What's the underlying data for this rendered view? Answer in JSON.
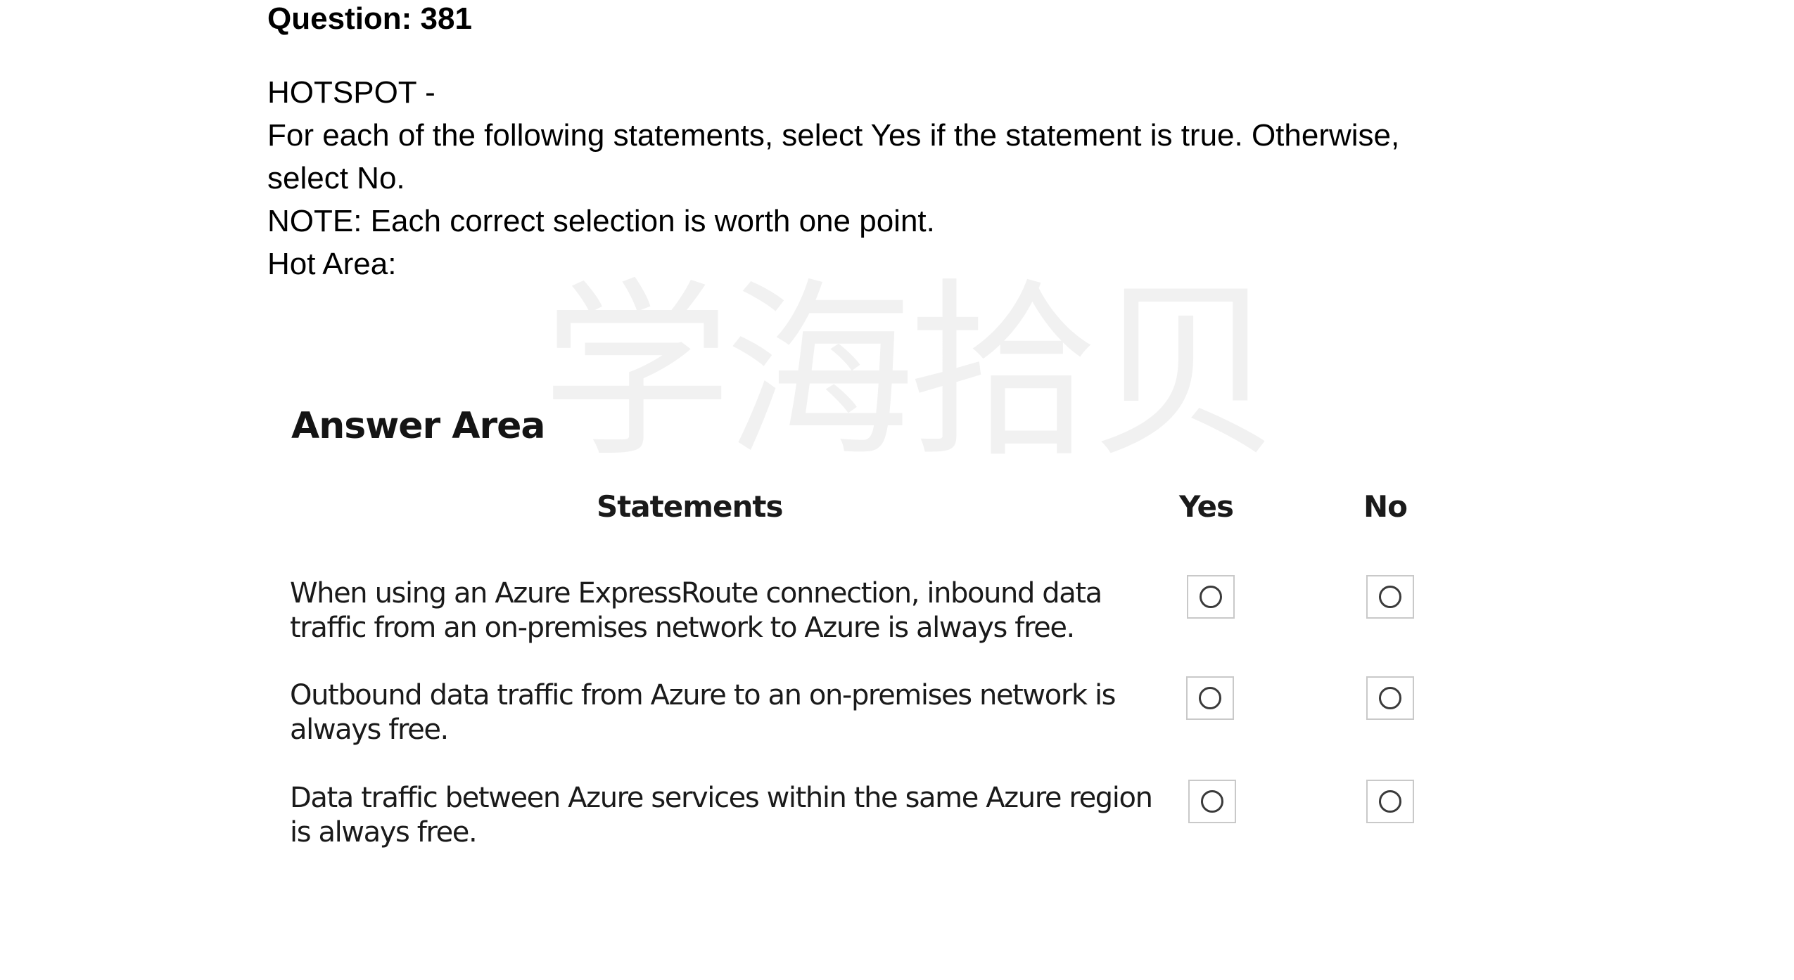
{
  "question": {
    "title": "Question: 381",
    "lines": [
      "HOTSPOT -",
      "For each of the following statements, select Yes if the statement is true. Otherwise,",
      "select No.",
      "NOTE: Each correct selection is worth one point.",
      "Hot Area:"
    ]
  },
  "watermark": "学海拾贝",
  "answer_area": {
    "title": "Answer Area",
    "headers": {
      "statements": "Statements",
      "yes": "Yes",
      "no": "No"
    },
    "statements": [
      {
        "line1": "When using an Azure ExpressRoute connection, inbound data",
        "line2": "traffic from an on-premises network to Azure is always free."
      },
      {
        "line1": "Outbound data traffic from Azure to an on-premises network is",
        "line2": "always free."
      },
      {
        "line1": "Data traffic between Azure services within the same Azure region",
        "line2": "is always free."
      }
    ]
  }
}
